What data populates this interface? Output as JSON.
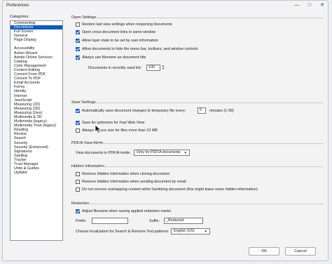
{
  "window": {
    "title": "Preferences",
    "minimize": "—",
    "maximize": "□",
    "close": "✕"
  },
  "categories": {
    "label": "Categories:",
    "top_items": [
      "Commenting",
      "Documents",
      "Full Screen",
      "General",
      "Page Display"
    ],
    "selected": "Documents",
    "items": [
      "Accessibility",
      "Action Wizard",
      "Adobe Online Services",
      "Catalog",
      "Color Management",
      "Content Editing",
      "Convert From PDF",
      "Convert To PDF",
      "Email Accounts",
      "Forms",
      "Identity",
      "Internet",
      "JavaScript",
      "Measuring (2D)",
      "Measuring (3D)",
      "Measuring (Geo)",
      "Multimedia & 3D",
      "Multimedia (legacy)",
      "Multimedia Trust (legacy)",
      "Reading",
      "Review",
      "Search",
      "Security",
      "Security (Enhanced)",
      "Signatures",
      "Spelling",
      "Tracker",
      "Trust Manager",
      "Units & Guides",
      "Updater"
    ]
  },
  "open_settings": {
    "title": "Open Settings",
    "options": [
      {
        "label": "Restore last view settings when reopening documents",
        "checked": false
      },
      {
        "label": "Open cross-document links in same window",
        "checked": true
      },
      {
        "label": "Allow layer state to be set by user information",
        "checked": true
      },
      {
        "label": "Allow documents to hide the menu bar, toolbars, and window controls",
        "checked": true
      },
      {
        "label": "Always use filename as document title",
        "checked": true
      }
    ],
    "recent_label": "Documents in recently used list:",
    "recent_value": "100"
  },
  "save_settings": {
    "title": "Save Settings",
    "autosave_label": "Automatically save document changes to temporary file every:",
    "autosave_checked": true,
    "autosave_value": "5",
    "autosave_unit": "minutes (1-99)",
    "fast_web_label": "Save As optimizes for Fast Web View",
    "fast_web_checked": true,
    "reduce_label": "Always reduce size for files more than 10 MB",
    "reduce_checked": false
  },
  "pdfa": {
    "title": "PDF/A View Mode",
    "label": "View documents in PDF/A mode:",
    "value": "Only for PDF/A documents",
    "arrow": "▼"
  },
  "hidden_info": {
    "title": "Hidden Information",
    "options": [
      {
        "label": "Remove Hidden Information when closing document",
        "checked": false
      },
      {
        "label": "Remove Hidden Information when sending document by email",
        "checked": false
      },
      {
        "label": "Do not remove overlapping content while Sanitizing document (this might leave some hidden information)",
        "checked": false
      }
    ]
  },
  "redaction": {
    "title": "Redaction",
    "adjust_label": "Adjust filename when saving applied redaction marks",
    "adjust_checked": true,
    "prefix_label": "Prefix:",
    "prefix_value": "",
    "suffix_label": "Suffix:",
    "suffix_value": "_Redacted",
    "locale_label": "Choose localization for Search & Remove Text patterns:",
    "locale_value": "English (US)",
    "arrow": "▼"
  },
  "buttons": {
    "ok": "OK",
    "cancel": "Cancel"
  }
}
